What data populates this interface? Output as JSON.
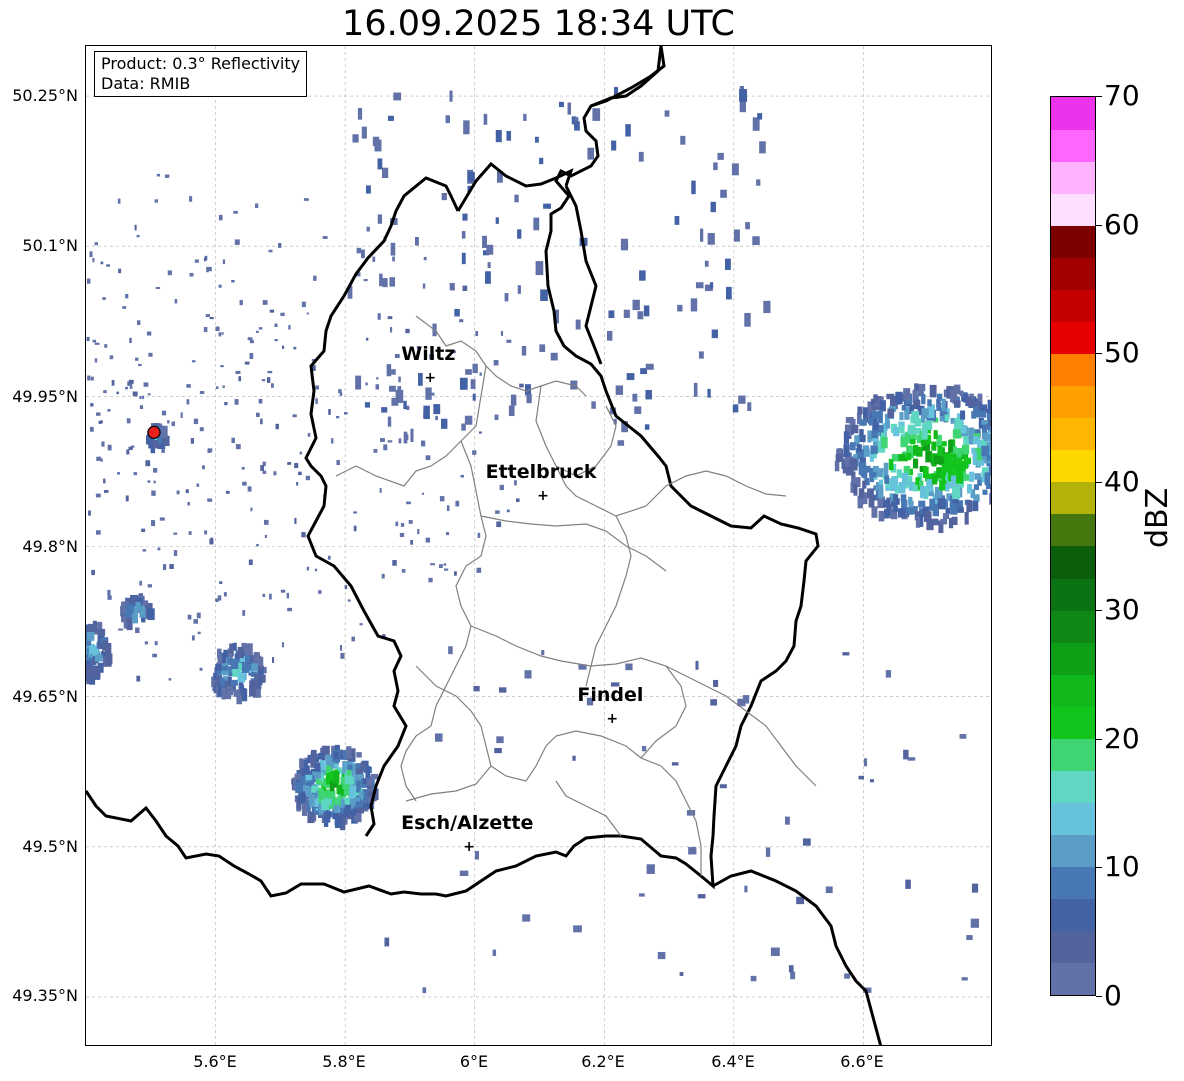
{
  "title": "16.09.2025 18:34 UTC",
  "product_box": {
    "line1": "Product: 0.3° Reflectivity",
    "line2": "Data: RMIB"
  },
  "lat_labels": [
    "50.25°N",
    "50.1°N",
    "49.95°N",
    "49.8°N",
    "49.65°N",
    "49.5°N",
    "49.35°N"
  ],
  "lon_labels": [
    "5.6°E",
    "5.8°E",
    "6°E",
    "6.2°E",
    "6.4°E",
    "6.6°E"
  ],
  "cities": [
    {
      "name": "Wiltz",
      "lon": 5.93,
      "lat": 49.966
    },
    {
      "name": "Ettelbruck",
      "lon": 6.104,
      "lat": 49.848
    },
    {
      "name": "Findel",
      "lon": 6.211,
      "lat": 49.626
    },
    {
      "name": "Esch/Alzette",
      "lon": 5.99,
      "lat": 49.498
    }
  ],
  "radar_site": {
    "lon": 5.505,
    "lat": 49.914,
    "color": "#e8201a"
  },
  "colorbar": {
    "label": "dBZ",
    "min": 0,
    "max": 70,
    "ticks": [
      "0",
      "10",
      "20",
      "30",
      "40",
      "50",
      "60",
      "70"
    ],
    "colors": [
      "#6272a8",
      "#52639e",
      "#4361a5",
      "#4778b4",
      "#5a9ec8",
      "#67c3dc",
      "#5fd7c2",
      "#3fd572",
      "#12c51d",
      "#10b81b",
      "#0e9f17",
      "#0f8716",
      "#0b7313",
      "#0a5e0c",
      "#46770f",
      "#b2b20b",
      "#ffd700",
      "#ffb600",
      "#ff9f00",
      "#ff7f00",
      "#e60000",
      "#c40000",
      "#a00000",
      "#7c0000",
      "#ffdfff",
      "#ffb3ff",
      "#ff66ff",
      "#ec33ec"
    ]
  },
  "axis": {
    "lon_range": [
      5.4,
      6.8
    ],
    "lat_range": [
      49.3,
      50.3
    ]
  },
  "echoes": [
    {
      "name": "west-cell",
      "lon": 5.505,
      "lat": 49.914
    },
    {
      "name": "west-cluster-1",
      "lon": 5.42,
      "lat": 49.69
    },
    {
      "name": "west-cluster-2",
      "lon": 5.63,
      "lat": 49.68
    },
    {
      "name": "south-storm",
      "lon": 5.78,
      "lat": 49.565
    },
    {
      "name": "east-storm",
      "lon": 6.7,
      "lat": 49.895
    }
  ]
}
